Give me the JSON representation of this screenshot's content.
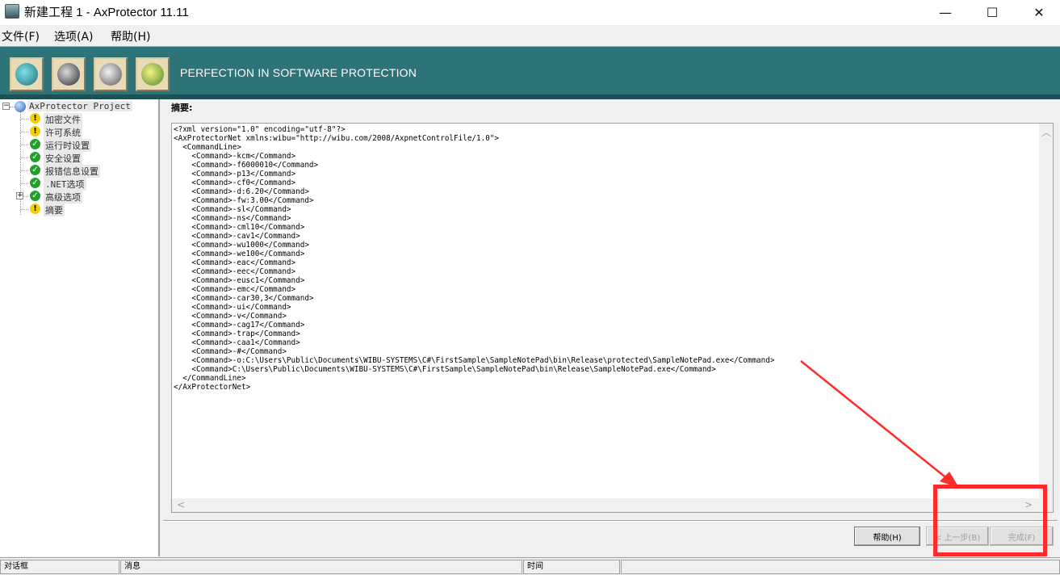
{
  "window": {
    "title": "新建工程 1 - AxProtector 11.11",
    "minimize": "—",
    "maximize": "☐",
    "close": "✕"
  },
  "menu": {
    "items": [
      "文件(F)",
      "选项(A)",
      "帮助(H)"
    ]
  },
  "banner": {
    "tagline": "PERFECTION IN SOFTWARE PROTECTION",
    "toolbar_icons": [
      "refresh-icon",
      "document-icon",
      "cd-icon",
      "gear-icon"
    ]
  },
  "tree": {
    "root": "AxProtector Project",
    "items": [
      {
        "label": "加密文件",
        "status": "warning"
      },
      {
        "label": "许可系统",
        "status": "warning"
      },
      {
        "label": "运行时设置",
        "status": "ok"
      },
      {
        "label": "安全设置",
        "status": "ok"
      },
      {
        "label": "报错信息设置",
        "status": "ok"
      },
      {
        "label": ".NET选项",
        "status": "ok"
      },
      {
        "label": "高级选项",
        "status": "ok",
        "expandable": true
      },
      {
        "label": "摘要",
        "status": "warning"
      }
    ]
  },
  "main": {
    "section_label": "摘要:",
    "xml": "<?xml version=\"1.0\" encoding=\"utf-8\"?>\n<AxProtectorNet xmlns:wibu=\"http://wibu.com/2008/AxpnetControlFile/1.0\">\n  <CommandLine>\n    <Command>-kcm</Command>\n    <Command>-f6000010</Command>\n    <Command>-p13</Command>\n    <Command>-cf0</Command>\n    <Command>-d:6.20</Command>\n    <Command>-fw:3.00</Command>\n    <Command>-sl</Command>\n    <Command>-ns</Command>\n    <Command>-cml10</Command>\n    <Command>-cav1</Command>\n    <Command>-wu1000</Command>\n    <Command>-we100</Command>\n    <Command>-eac</Command>\n    <Command>-eec</Command>\n    <Command>-eusc1</Command>\n    <Command>-emc</Command>\n    <Command>-car30,3</Command>\n    <Command>-ui</Command>\n    <Command>-v</Command>\n    <Command>-cag17</Command>\n    <Command>-trap</Command>\n    <Command>-caa1</Command>\n    <Command>-#</Command>\n    <Command>-o:C:\\Users\\Public\\Documents\\WIBU-SYSTEMS\\C#\\FirstSample\\SampleNotePad\\bin\\Release\\protected\\SampleNotePad.exe</Command>\n    <Command>C:\\Users\\Public\\Documents\\WIBU-SYSTEMS\\C#\\FirstSample\\SampleNotePad\\bin\\Release\\SampleNotePad.exe</Command>\n  </CommandLine>\n</AxProtectorNet>"
  },
  "buttons": {
    "help": "帮助(H)",
    "back": "< 上一步(B)",
    "finish": "完成(F)"
  },
  "statusbar": {
    "dialog": "对话框",
    "message": "消息",
    "time": "时间"
  },
  "colors": {
    "banner": "#2e7378",
    "annotation": "#ff2a2a"
  }
}
